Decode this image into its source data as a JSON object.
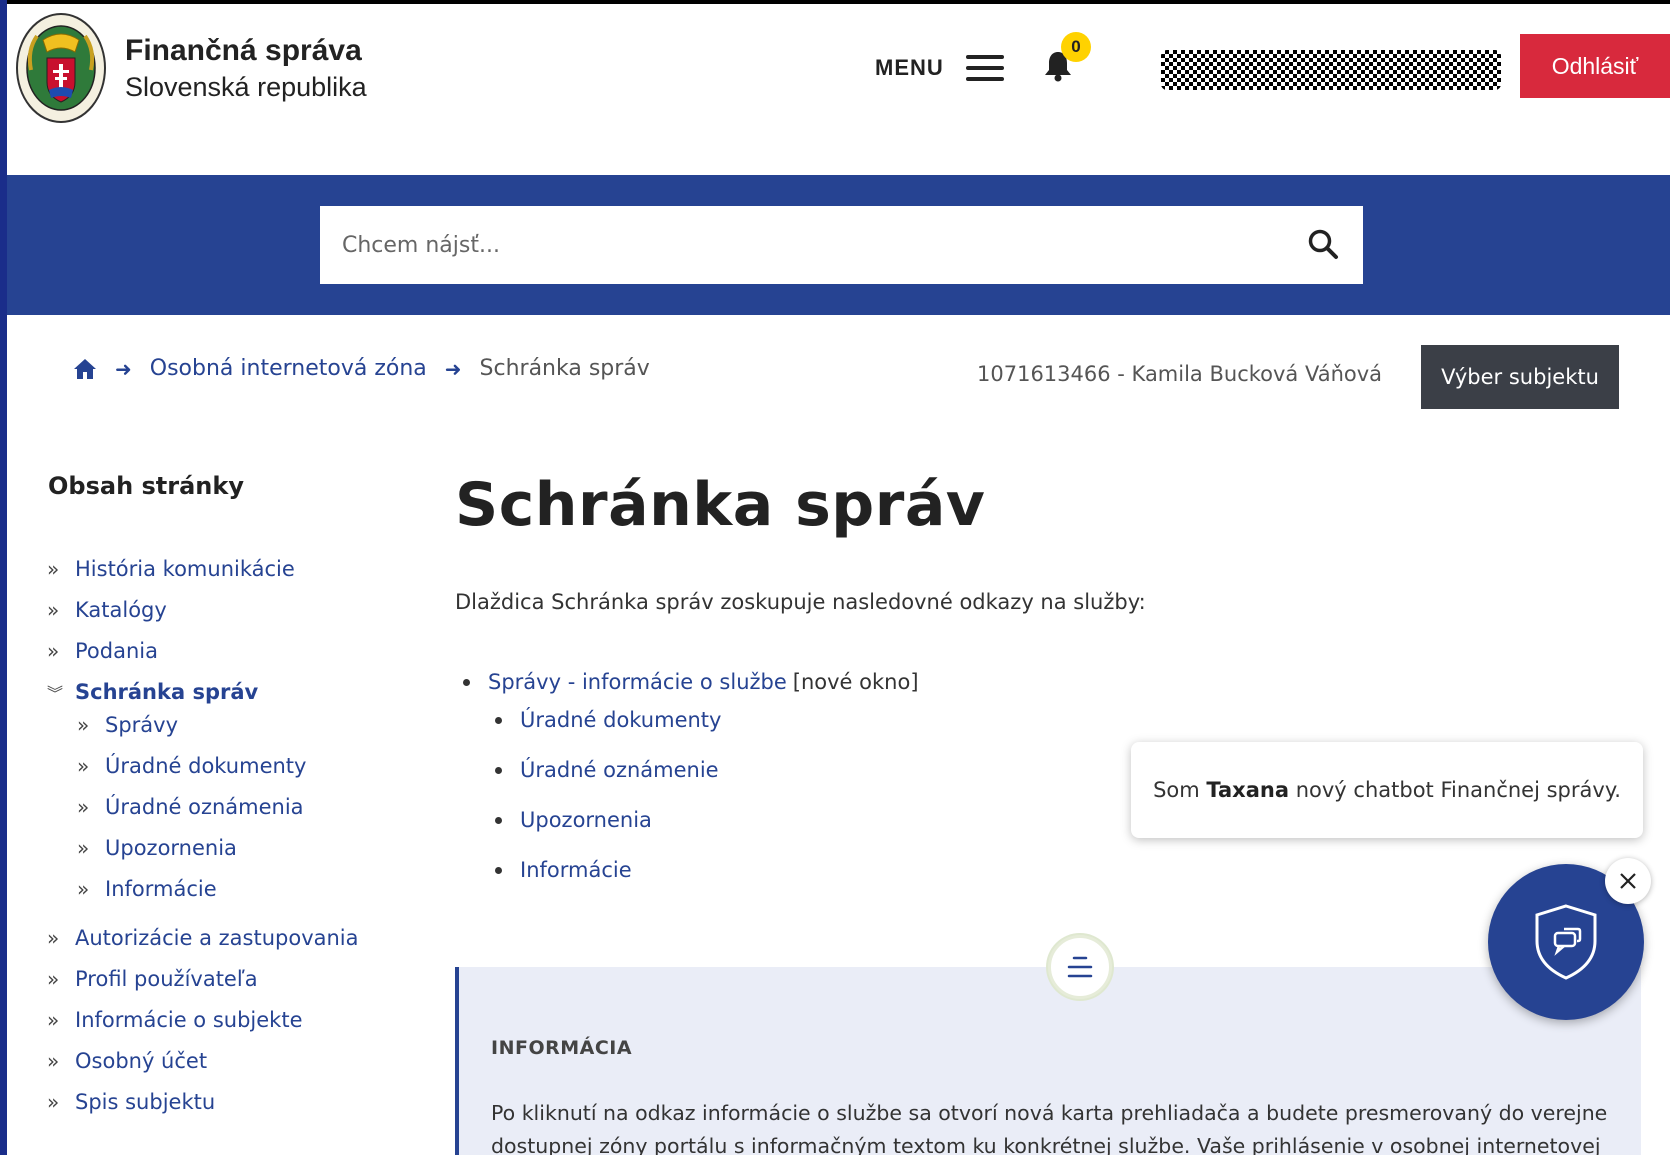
{
  "header": {
    "brand_title": "Finančná správa",
    "brand_subtitle": "Slovenská republika",
    "logo_icon": "coat-of-arms-logo",
    "menu_label": "MENU",
    "notifications_count": "0",
    "logout_label": "Odhlásiť"
  },
  "search": {
    "placeholder": "Chcem nájsť..."
  },
  "breadcrumb": {
    "home_icon": "home-icon",
    "items": [
      "Osobná internetová zóna",
      "Schránka správ"
    ]
  },
  "subject": {
    "label": "1071613466 - Kamila Bucková Váňová",
    "button_label": "Výber subjektu"
  },
  "sidebar": {
    "title": "Obsah stránky",
    "items": [
      {
        "label": "História komunikácie"
      },
      {
        "label": "Katalógy"
      },
      {
        "label": "Podania"
      },
      {
        "label": "Schránka správ"
      },
      {
        "label": "Správy"
      },
      {
        "label": "Úradné dokumenty"
      },
      {
        "label": "Úradné oznámenia"
      },
      {
        "label": "Upozornenia"
      },
      {
        "label": "Informácie"
      },
      {
        "label": "Autorizácie a zastupovania"
      },
      {
        "label": "Profil používateľa"
      },
      {
        "label": "Informácie o subjekte"
      },
      {
        "label": "Osobný účet"
      },
      {
        "label": "Spis subjektu"
      }
    ]
  },
  "main": {
    "title": "Schránka správ",
    "intro": "Dlaždica Schránka správ zoskupuje nasledovné odkazy na služby:",
    "services": {
      "primary_link": "Správy - informácie o službe",
      "primary_note": "[nové okno]",
      "sub_links": [
        "Úradné dokumenty",
        "Úradné oznámenie",
        "Upozornenia",
        "Informácie"
      ]
    },
    "info": {
      "heading": "INFORMÁCIA",
      "text": "Po kliknutí na odkaz informácie o službe sa otvorí nová karta prehliadača a budete presmerovaný do verejne dostupnej zóny portálu s informačným textom ku konkrétnej službe. Vaše prihlásenie v osobnej internetovej"
    }
  },
  "chatbot": {
    "text_before": "Som",
    "name": "Taxana",
    "text_after": "nový chatbot Finančnej správy."
  },
  "colors": {
    "brand_blue": "#264392",
    "logout_red": "#d8293d",
    "badge_yellow": "#ffd200",
    "dark_button": "#3b3f47"
  }
}
